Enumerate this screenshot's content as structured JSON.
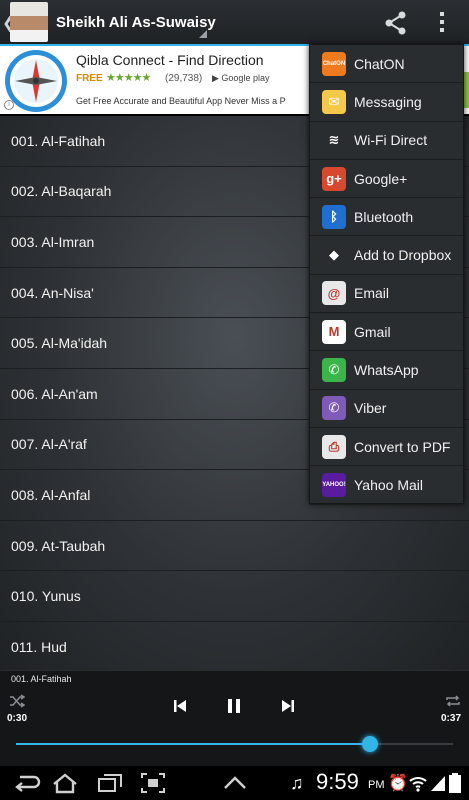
{
  "header": {
    "title": "Sheikh Ali As-Suwaisy"
  },
  "ad": {
    "title": "Qibla Connect - Find Direction",
    "free_label": "FREE",
    "stars": "★★★★★",
    "rating_count": "(29,738)",
    "store_badge": "Google play",
    "description": "Get Free Accurate and Beautiful App Never Miss a P"
  },
  "tracks": [
    "001. Al-Fatihah",
    "002. Al-Baqarah",
    "003. Al-Imran",
    "004. An-Nisa'",
    "005. Al-Ma'idah",
    "006. Al-An'am",
    "007. Al-A'raf",
    "008. Al-Anfal",
    "009. At-Taubah",
    "010. Yunus",
    "011. Hud"
  ],
  "share_menu": [
    {
      "label": "ChatON",
      "icon": "chaton-icon",
      "color": "#f07a1e",
      "glyph": "ChatON"
    },
    {
      "label": "Messaging",
      "icon": "messaging-icon",
      "color": "#f6c84a",
      "glyph": "✉"
    },
    {
      "label": "Wi-Fi Direct",
      "icon": "wifi-direct-icon",
      "color": "#2a2d30",
      "glyph": "≋"
    },
    {
      "label": "Google+",
      "icon": "google-plus-icon",
      "color": "#d6492f",
      "glyph": "g+"
    },
    {
      "label": "Bluetooth",
      "icon": "bluetooth-icon",
      "color": "#1f6fd1",
      "glyph": "ᛒ"
    },
    {
      "label": "Add to Dropbox",
      "icon": "dropbox-icon",
      "color": "#2a2d30",
      "glyph": "◆"
    },
    {
      "label": "Email",
      "icon": "email-icon",
      "color": "#e8e8e8",
      "glyph": "@"
    },
    {
      "label": "Gmail",
      "icon": "gmail-icon",
      "color": "#ffffff",
      "glyph": "M"
    },
    {
      "label": "WhatsApp",
      "icon": "whatsapp-icon",
      "color": "#3bb54a",
      "glyph": "✆"
    },
    {
      "label": "Viber",
      "icon": "viber-icon",
      "color": "#7d5bb6",
      "glyph": "✆"
    },
    {
      "label": "Convert to PDF",
      "icon": "pdf-icon",
      "color": "#e8e8e8",
      "glyph": "⎙"
    },
    {
      "label": "Yahoo Mail",
      "icon": "yahoo-mail-icon",
      "color": "#5a1c9e",
      "glyph": "YAHOO!"
    }
  ],
  "player": {
    "now_playing": "001. Al-Fatihah",
    "current_time": "0:30",
    "total_time": "0:37",
    "progress": 0.81
  },
  "status": {
    "time": "9:59",
    "ampm": "PM"
  },
  "colors": {
    "accent": "#31b6e7",
    "popup_bg": "#2a2d30",
    "list_bg": "#2e3236"
  }
}
